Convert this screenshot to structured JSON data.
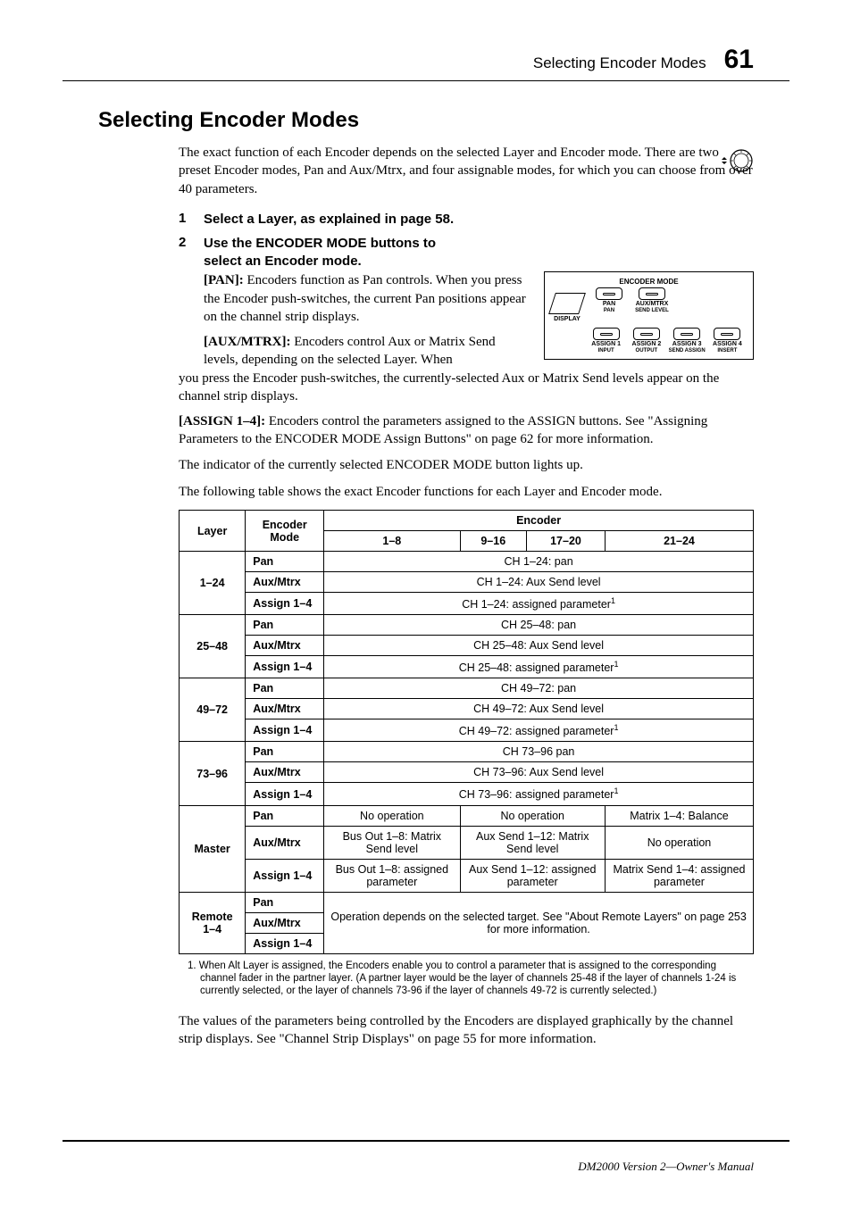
{
  "header": {
    "title": "Selecting Encoder Modes",
    "page": "61"
  },
  "h1": "Selecting Encoder Modes",
  "intro": "The exact function of each Encoder depends on the selected Layer and Encoder mode. There are two preset Encoder modes, Pan and Aux/Mtrx, and four assignable modes, for which you can choose from over 40 parameters.",
  "step1": {
    "num": "1",
    "text": "Select a Layer, as explained in page 58."
  },
  "step2": {
    "num": "2",
    "text": "Use the ENCODER MODE buttons to select an Encoder mode."
  },
  "pan": {
    "label": "[PAN]:",
    "text": " Encoders function as Pan controls. When you press the Encoder push-switches, the current Pan positions appear on the channel strip displays."
  },
  "aux_left": {
    "label": "[AUX/MTRX]:",
    "text": " Encoders control Aux or Matrix Send levels, depending on the selected Layer. When"
  },
  "aux_wrap": "you press the Encoder push-switches, the currently-selected Aux or Matrix Send levels appear on the channel strip displays.",
  "assign": {
    "label": "[ASSIGN 1–4]:",
    "text": " Encoders control the parameters assigned to the ASSIGN buttons. See \"Assigning Parameters to the ENCODER MODE Assign Buttons\" on page 62 for more information."
  },
  "indicator": "The indicator of the currently selected ENCODER MODE button lights up.",
  "table_intro": "The following table shows the exact Encoder functions for each Layer and Encoder mode.",
  "diagram": {
    "title": "ENCODER MODE",
    "display": "DISPLAY",
    "btns_top": [
      {
        "label": "PAN",
        "sub": "PAN"
      },
      {
        "label": "AUX/MTRX",
        "sub": "SEND LEVEL"
      }
    ],
    "btns_bottom": [
      {
        "label": "ASSIGN 1",
        "sub": "INPUT"
      },
      {
        "label": "ASSIGN 2",
        "sub": "OUTPUT"
      },
      {
        "label": "ASSIGN 3",
        "sub": "SEND ASSIGN"
      },
      {
        "label": "ASSIGN 4",
        "sub": "INSERT"
      }
    ]
  },
  "table": {
    "header": {
      "layer": "Layer",
      "mode": "Encoder Mode",
      "enc": "Encoder",
      "cols": [
        "1–8",
        "9–16",
        "17–20",
        "21–24"
      ]
    },
    "groups": [
      {
        "layer": "1–24",
        "rows": [
          {
            "mode": "Pan",
            "cells": [
              "CH 1–24: pan"
            ]
          },
          {
            "mode": "Aux/Mtrx",
            "cells": [
              "CH 1–24: Aux Send level"
            ]
          },
          {
            "mode": "Assign 1–4",
            "cells_sup": [
              "CH 1–24: assigned parameter"
            ]
          }
        ]
      },
      {
        "layer": "25–48",
        "rows": [
          {
            "mode": "Pan",
            "cells": [
              "CH 25–48: pan"
            ]
          },
          {
            "mode": "Aux/Mtrx",
            "cells": [
              "CH 25–48: Aux Send level"
            ]
          },
          {
            "mode": "Assign 1–4",
            "cells_sup": [
              "CH 25–48: assigned parameter"
            ]
          }
        ]
      },
      {
        "layer": "49–72",
        "rows": [
          {
            "mode": "Pan",
            "cells": [
              "CH 49–72: pan"
            ]
          },
          {
            "mode": "Aux/Mtrx",
            "cells": [
              "CH 49–72: Aux Send level"
            ]
          },
          {
            "mode": "Assign 1–4",
            "cells_sup": [
              "CH 49–72: assigned parameter"
            ]
          }
        ]
      },
      {
        "layer": "73–96",
        "rows": [
          {
            "mode": "Pan",
            "cells": [
              "CH 73–96 pan"
            ]
          },
          {
            "mode": "Aux/Mtrx",
            "cells": [
              "CH 73–96: Aux Send level"
            ]
          },
          {
            "mode": "Assign 1–4",
            "cells_sup": [
              "CH 73–96: assigned parameter"
            ]
          }
        ]
      }
    ],
    "master": {
      "layer": "Master",
      "rows": [
        {
          "mode": "Pan",
          "cells": [
            "No operation",
            "No operation",
            "Matrix 1–4: Balance"
          ]
        },
        {
          "mode": "Aux/Mtrx",
          "cells": [
            "Bus Out 1–8: Matrix Send level",
            "Aux Send 1–12: Matrix Send level",
            "No operation"
          ]
        },
        {
          "mode": "Assign 1–4",
          "cells": [
            "Bus Out 1–8: assigned parameter",
            "Aux Send 1–12: assigned parameter",
            "Matrix Send 1–4: assigned parameter"
          ]
        }
      ]
    },
    "remote": {
      "layer": "Remote 1–4",
      "modes": [
        "Pan",
        "Aux/Mtrx",
        "Assign 1–4"
      ],
      "text": "Operation depends on the selected target. See \"About Remote Layers\" on page 253 for more information."
    }
  },
  "footnote": "1.  When Alt Layer is assigned, the Encoders enable you to control a parameter that is assigned to the corresponding channel fader in the partner layer. (A partner layer would be the layer of channels 25-48 if the layer of channels 1-24 is currently selected, or the layer of channels 73-96 if the layer of channels 49-72 is currently selected.)",
  "post": "The values of the parameters being controlled by the Encoders are displayed graphically by the channel strip displays. See \"Channel Strip Displays\" on page 55 for more information.",
  "footer": "DM2000 Version 2—Owner's Manual",
  "sup": "1"
}
